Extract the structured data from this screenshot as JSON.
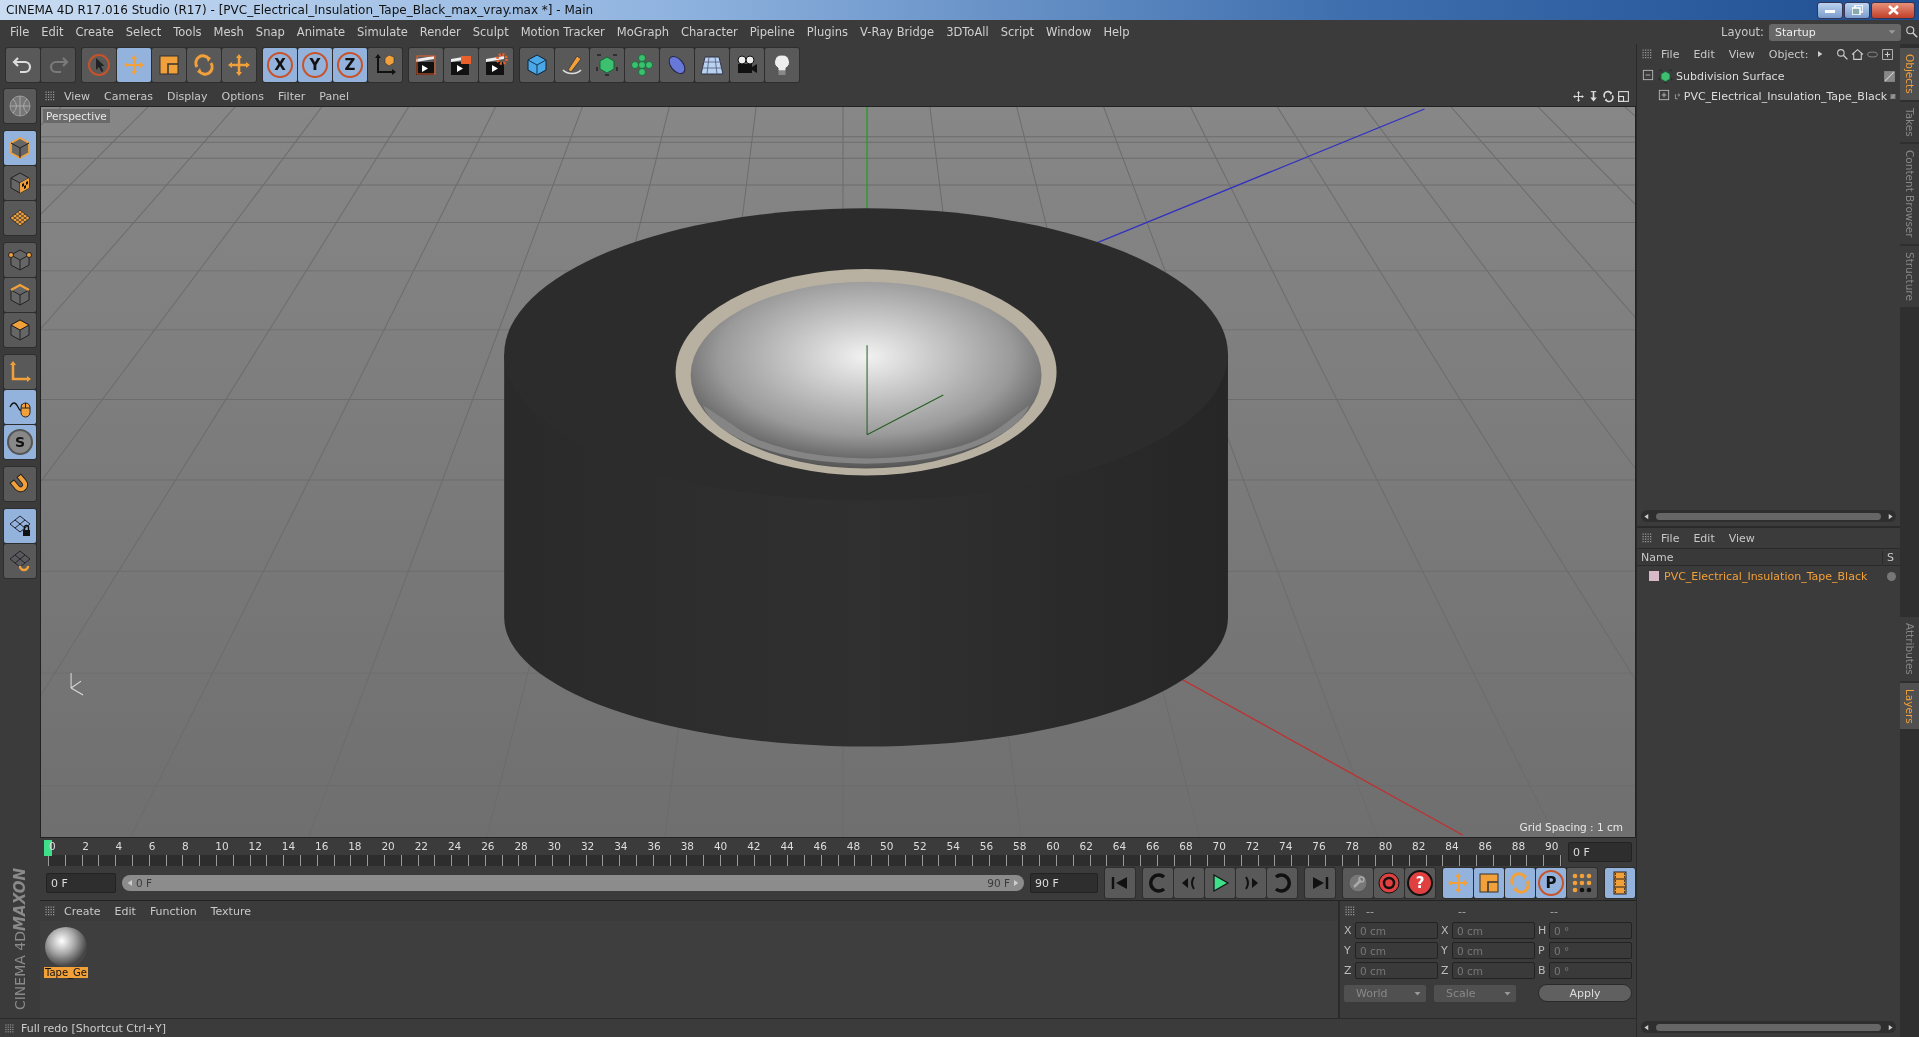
{
  "window": {
    "title": "CINEMA 4D R17.016 Studio (R17) - [PVC_Electrical_Insulation_Tape_Black_max_vray.max *] - Main"
  },
  "menu": [
    "File",
    "Edit",
    "Create",
    "Select",
    "Tools",
    "Mesh",
    "Snap",
    "Animate",
    "Simulate",
    "Render",
    "Sculpt",
    "Motion Tracker",
    "MoGraph",
    "Character",
    "Pipeline",
    "Plugins",
    "V-Ray Bridge",
    "3DToAll",
    "Script",
    "Window",
    "Help"
  ],
  "layout": {
    "label": "Layout:",
    "value": "Startup"
  },
  "history": [
    {
      "kind": "undo",
      "disabled": false
    },
    {
      "kind": "redo",
      "disabled": true
    }
  ],
  "toolbar": [
    [
      {
        "kind": "pointer",
        "selected": false
      },
      {
        "kind": "move",
        "selected": true
      },
      {
        "kind": "scale",
        "selected": false
      },
      {
        "kind": "rotate",
        "selected": false
      },
      {
        "kind": "add",
        "selected": false
      }
    ],
    [
      {
        "kind": "axis",
        "label": "X",
        "selected": true
      },
      {
        "kind": "axis",
        "label": "Y",
        "selected": true
      },
      {
        "kind": "axis",
        "label": "Z",
        "selected": true
      },
      {
        "kind": "coords",
        "selected": false
      }
    ],
    [
      {
        "kind": "render-view",
        "selected": false
      },
      {
        "kind": "render-picture",
        "selected": false
      },
      {
        "kind": "render-settings",
        "selected": false
      }
    ],
    [
      {
        "kind": "cube",
        "selected": false
      },
      {
        "kind": "pen",
        "selected": false
      },
      {
        "kind": "subdivision",
        "selected": false
      },
      {
        "kind": "cloner",
        "selected": false
      },
      {
        "kind": "deformer",
        "selected": false
      },
      {
        "kind": "floor",
        "selected": false
      },
      {
        "kind": "camera",
        "selected": false
      },
      {
        "kind": "light",
        "selected": false
      }
    ]
  ],
  "left_tools": [
    [
      {
        "kind": "solo",
        "selected": false
      }
    ],
    [
      {
        "kind": "model",
        "selected": true
      },
      {
        "kind": "texture",
        "selected": false
      },
      {
        "kind": "workplane",
        "selected": false
      }
    ],
    [
      {
        "kind": "points",
        "selected": false
      },
      {
        "kind": "edges",
        "selected": false
      },
      {
        "kind": "polygons",
        "selected": false
      }
    ],
    [
      {
        "kind": "axis-tool",
        "selected": false
      },
      {
        "kind": "tweak",
        "selected": true
      },
      {
        "kind": "snap",
        "label": "S",
        "selected": true
      }
    ],
    [
      {
        "kind": "magnet",
        "selected": false
      }
    ],
    [
      {
        "kind": "lock-grid",
        "selected": true
      },
      {
        "kind": "grid-rotate",
        "selected": false
      }
    ]
  ],
  "viewport": {
    "menu": [
      "View",
      "Cameras",
      "Display",
      "Options",
      "Filter",
      "Panel"
    ],
    "camera": "Perspective",
    "grid_spacing": "Grid Spacing : 1 cm"
  },
  "timeline": {
    "ticks": [
      "0",
      "2",
      "4",
      "6",
      "8",
      "10",
      "12",
      "14",
      "16",
      "18",
      "20",
      "22",
      "24",
      "26",
      "28",
      "30",
      "32",
      "34",
      "36",
      "38",
      "40",
      "42",
      "44",
      "46",
      "48",
      "50",
      "52",
      "54",
      "56",
      "58",
      "60",
      "62",
      "64",
      "66",
      "68",
      "70",
      "72",
      "74",
      "76",
      "78",
      "80",
      "82",
      "84",
      "86",
      "88",
      "90"
    ],
    "current_frame": "0 F",
    "start_field": "0 F",
    "range_start": "0 F",
    "range_end": "90 F",
    "end_field": "90 F",
    "range": {
      "level": 1
    }
  },
  "transport": [
    [
      {
        "kind": "first"
      }
    ],
    [
      {
        "kind": "prev-key"
      },
      {
        "kind": "prev-frame"
      },
      {
        "kind": "play"
      },
      {
        "kind": "next-frame"
      },
      {
        "kind": "next-key"
      }
    ],
    [
      {
        "kind": "last"
      }
    ],
    [
      {
        "kind": "keys"
      },
      {
        "kind": "record"
      },
      {
        "kind": "autokey",
        "label": "?"
      }
    ]
  ],
  "key_modes": [
    {
      "kind": "move",
      "selected": true
    },
    {
      "kind": "scale",
      "selected": true
    },
    {
      "kind": "rotate",
      "selected": true
    },
    {
      "kind": "param",
      "label": "P",
      "selected": true
    },
    {
      "kind": "dots",
      "selected": false
    }
  ],
  "timeline_button": {
    "selected": true
  },
  "materials": {
    "menu": [
      "Create",
      "Edit",
      "Function",
      "Texture"
    ],
    "items": [
      {
        "name": "Tape_Ge",
        "selected": true
      }
    ]
  },
  "coordinates": {
    "headers": [
      "--",
      "--",
      "--"
    ],
    "columns": [
      [
        {
          "axis": "X",
          "value": "0 cm"
        },
        {
          "axis": "Y",
          "value": "0 cm"
        },
        {
          "axis": "Z",
          "value": "0 cm"
        }
      ],
      [
        {
          "axis": "X",
          "value": "0 cm"
        },
        {
          "axis": "Y",
          "value": "0 cm"
        },
        {
          "axis": "Z",
          "value": "0 cm"
        }
      ],
      [
        {
          "axis": "H",
          "value": "0 °"
        },
        {
          "axis": "P",
          "value": "0 °"
        },
        {
          "axis": "B",
          "value": "0 °"
        }
      ]
    ],
    "mode": "World",
    "size_mode": "Scale",
    "apply": "Apply"
  },
  "logo": {
    "brand": "MAXON",
    "product": "CINEMA 4D"
  },
  "status_bar": "Full redo [Shortcut Ctrl+Y]",
  "objects": {
    "menu": [
      "File",
      "Edit",
      "View",
      "Object:"
    ],
    "tree": [
      {
        "name": "Subdivision Surface",
        "kind": "subdivision",
        "expanded": true,
        "children": [
          {
            "name": "PVC_Electrical_Insulation_Tape_Black",
            "kind": "null",
            "expanded": false
          }
        ]
      }
    ]
  },
  "layers": {
    "menu": [
      "File",
      "Edit",
      "View"
    ],
    "columns": [
      "Name",
      "S"
    ],
    "items": [
      {
        "name": "PVC_Electrical_Insulation_Tape_Black",
        "color": "#d9b8c8"
      }
    ]
  },
  "side_tabs_top": [
    {
      "label": "Objects",
      "selected": true
    },
    {
      "label": "Takes",
      "selected": false
    },
    {
      "label": "Content Browser",
      "selected": false
    },
    {
      "label": "Structure",
      "selected": false
    }
  ],
  "side_tabs_bottom": [
    {
      "label": "Attributes",
      "selected": false
    },
    {
      "label": "Layers",
      "selected": true
    }
  ]
}
